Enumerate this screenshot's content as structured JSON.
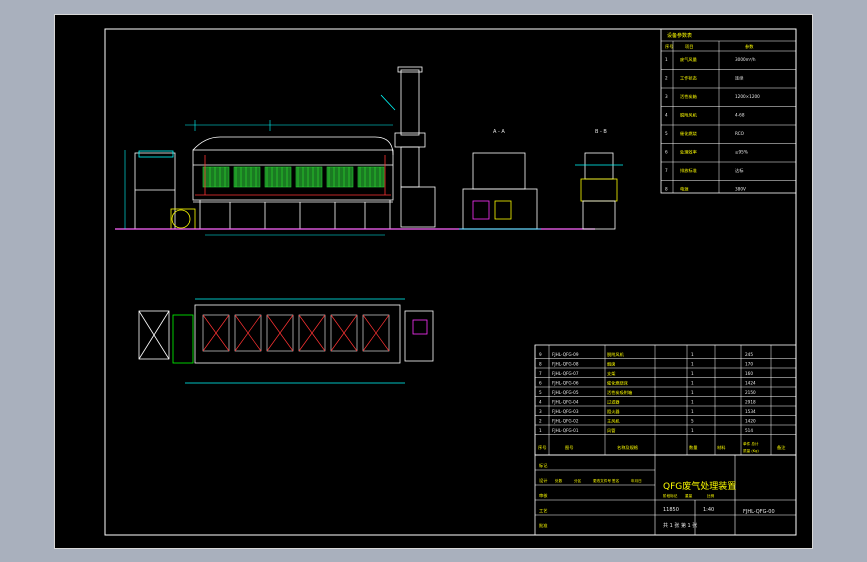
{
  "colors": {
    "background": "#a9b0bd",
    "paper": "#000000",
    "line": "#ffffff",
    "dim": "#00ffff",
    "accent": "#ff3333",
    "filter": "#22cc33",
    "ground": "#ff66ff",
    "label": "#ffff00",
    "equipment": "#ff33ff"
  },
  "views": {
    "section_a": "A - A",
    "section_b": "B - B"
  },
  "spec_table": {
    "title": "设备参数表",
    "header": [
      "序号",
      "项目",
      "参数"
    ],
    "rows": [
      {
        "no": "1",
        "item": "废气风量",
        "value": "3000m³/h"
      },
      {
        "no": "2",
        "item": "工作状态",
        "value": "连续"
      },
      {
        "no": "3",
        "item": "活性炭箱",
        "value": "1200×1200"
      },
      {
        "no": "4",
        "item": "脱附风机",
        "value": "4-68"
      },
      {
        "no": "5",
        "item": "催化燃烧",
        "value": "RCO"
      },
      {
        "no": "6",
        "item": "处理效率",
        "value": "≥95%"
      },
      {
        "no": "7",
        "item": "排放标准",
        "value": "达标"
      },
      {
        "no": "8",
        "item": "电源",
        "value": "380V"
      }
    ]
  },
  "parts_list": {
    "rows": [
      {
        "no": "9",
        "code": "FJHL-QFG-09",
        "name": "脱附风机",
        "qty": "1",
        "mass": "245"
      },
      {
        "no": "8",
        "code": "FJHL-QFG-08",
        "name": "烟囱",
        "qty": "1",
        "mass": "170"
      },
      {
        "no": "7",
        "code": "FJHL-QFG-07",
        "name": "支架",
        "qty": "1",
        "mass": "160"
      },
      {
        "no": "6",
        "code": "FJHL-QFG-06",
        "name": "催化燃烧床",
        "qty": "1",
        "mass": "1424"
      },
      {
        "no": "5",
        "code": "FJHL-QFG-05",
        "name": "活性炭吸附箱",
        "qty": "1",
        "mass": "2150"
      },
      {
        "no": "4",
        "code": "FJHL-QFG-04",
        "name": "过滤器",
        "qty": "1",
        "mass": "2918"
      },
      {
        "no": "3",
        "code": "FJHL-QFG-03",
        "name": "阻火器",
        "qty": "1",
        "mass": "1534"
      },
      {
        "no": "2",
        "code": "FJHL-QFG-02",
        "name": "主风机",
        "qty": "5",
        "mass": "1420"
      },
      {
        "no": "1",
        "code": "FJHL-QFG-01",
        "name": "风管",
        "qty": "1",
        "mass": "514"
      }
    ],
    "header": {
      "no": "序号",
      "code": "图号",
      "name": "名称及规格",
      "qty": "数量",
      "material": "材料",
      "mass": "单件 总计",
      "mass_sub": "质量 (Kg)",
      "note": "备注"
    }
  },
  "title_block": {
    "title": "QFG废气处理装置",
    "drawing_no": "FJHL-QFG-00",
    "scale": "1:40",
    "weight": "11850",
    "row_labels": [
      "标记",
      "设计",
      "审核",
      "工艺",
      "批准"
    ],
    "col_labels": [
      "处数",
      "分区",
      "更改文件号",
      "签名",
      "年月日"
    ],
    "stage_labels": [
      "阶段标记",
      "重量",
      "比例"
    ],
    "sheet": "共 1 张 第 1 张"
  }
}
